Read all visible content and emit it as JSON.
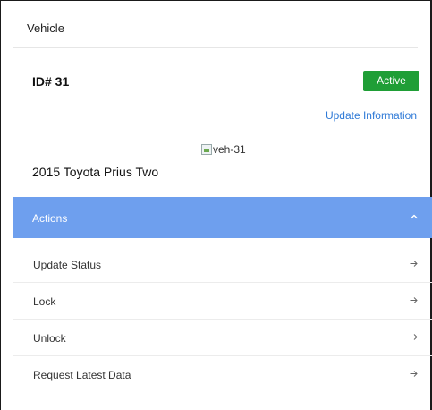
{
  "header": {
    "title": "Vehicle"
  },
  "vehicle": {
    "id_label": "ID# 31",
    "status": "Active",
    "update_link": "Update Information",
    "image_alt": "veh-31",
    "name": "2015 Toyota Prius Two"
  },
  "actions": {
    "title": "Actions",
    "items": [
      {
        "label": "Update Status"
      },
      {
        "label": "Lock"
      },
      {
        "label": "Unlock"
      },
      {
        "label": "Request Latest Data"
      }
    ]
  },
  "colors": {
    "status_active": "#1f9e36",
    "link": "#2f7ad7",
    "actions_bar": "#6e9fee"
  },
  "icons": {
    "actions_toggle": "chevron-up-icon",
    "item_action": "arrow-right-icon",
    "image_placeholder": "broken-image-icon"
  }
}
